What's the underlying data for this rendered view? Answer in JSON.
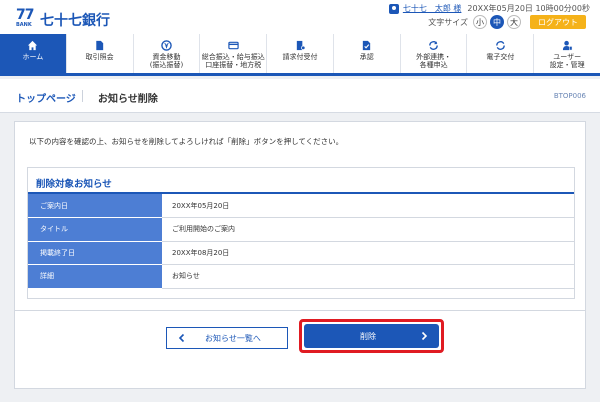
{
  "header": {
    "logo_num": "77",
    "logo_bank": "BANK",
    "logo_text": "七十七銀行",
    "user_name": "七十七　太郎 様",
    "login_time": "20XX年05月20日 10時00分00秒",
    "font_size_label": "文字サイズ",
    "font_sizes": [
      "小",
      "中",
      "大"
    ],
    "logout_label": "ログアウト"
  },
  "nav": {
    "items": [
      {
        "label": "ホーム",
        "active": true
      },
      {
        "label": "取引照会"
      },
      {
        "label": "資金移動\n(振込振替)"
      },
      {
        "label": "総合振込・給与振込\n口座振替・地方税"
      },
      {
        "label": "請求付受付"
      },
      {
        "label": "承認"
      },
      {
        "label": "外部連携・\n各種申込"
      },
      {
        "label": "電子交付"
      },
      {
        "label": "ユーザー\n設定・管理"
      }
    ]
  },
  "breadcrumb": {
    "top": "トップページ",
    "current": "お知らせ削除",
    "screen_id": "BTOP006"
  },
  "main": {
    "instruction": "以下の内容を確認の上、お知らせを削除してよろしければ「削除」ボタンを押してください。",
    "section_title": "削除対象お知らせ",
    "rows": [
      {
        "label": "ご案内日",
        "value": "20XX年05月20日"
      },
      {
        "label": "タイトル",
        "value": "ご利用開始のご案内"
      },
      {
        "label": "掲載終了日",
        "value": "20XX年08月20日"
      },
      {
        "label": "詳細",
        "value": "お知らせ"
      }
    ],
    "back_label": "お知らせ一覧へ",
    "delete_label": "削除"
  },
  "colors": {
    "primary": "#1c57b7",
    "table_header": "#4d7ed4",
    "logout": "#f5b219",
    "highlight": "#e01b22"
  }
}
